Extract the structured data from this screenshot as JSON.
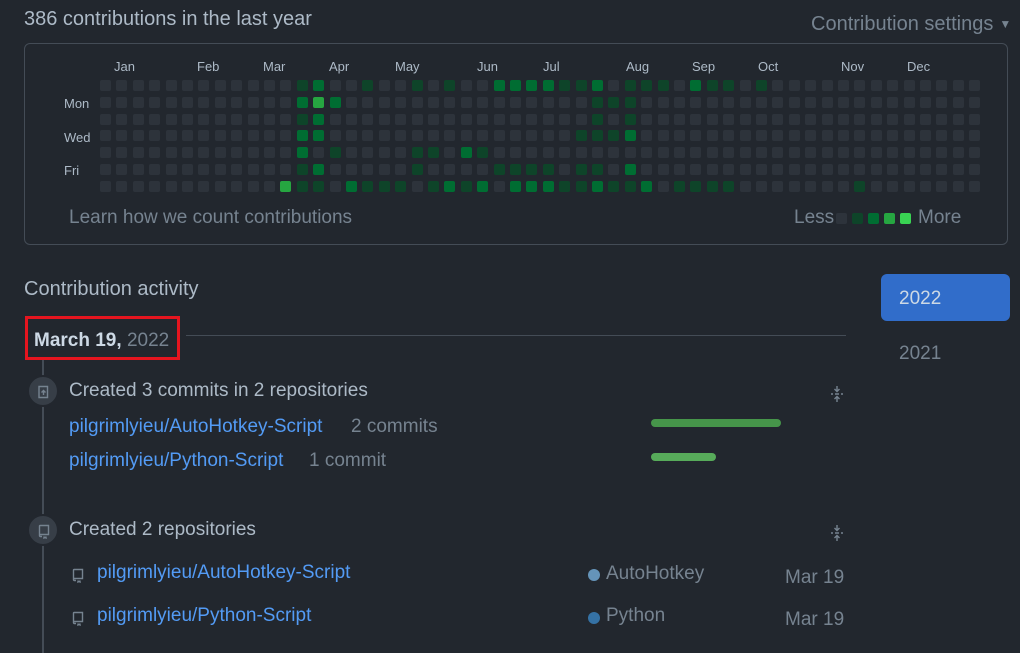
{
  "header": {
    "contrib_count": "386 contributions in the last year",
    "settings": "Contribution settings"
  },
  "calendar": {
    "months": [
      "Jan",
      "Feb",
      "Mar",
      "Apr",
      "May",
      "Jun",
      "Jul",
      "Aug",
      "Sep",
      "Oct",
      "Nov",
      "Dec"
    ],
    "days": [
      "Mon",
      "Wed",
      "Fri"
    ],
    "learn_link": "Learn how we count contributions",
    "legend_less": "Less",
    "legend_more": "More",
    "level_colors": [
      "#2d333b",
      "#0e4429",
      "#006d32",
      "#26a641",
      "#39d353"
    ],
    "weeks": 42,
    "active": [
      [
        11,
        6,
        3
      ],
      [
        12,
        0,
        1
      ],
      [
        12,
        1,
        2
      ],
      [
        12,
        2,
        1
      ],
      [
        12,
        3,
        2
      ],
      [
        12,
        4,
        2
      ],
      [
        12,
        5,
        1
      ],
      [
        12,
        6,
        1
      ],
      [
        13,
        0,
        2
      ],
      [
        13,
        1,
        3
      ],
      [
        13,
        2,
        2
      ],
      [
        13,
        3,
        2
      ],
      [
        13,
        5,
        2
      ],
      [
        13,
        6,
        1
      ],
      [
        14,
        1,
        2
      ],
      [
        14,
        4,
        1
      ],
      [
        15,
        6,
        2
      ],
      [
        16,
        0,
        1
      ],
      [
        16,
        6,
        1
      ],
      [
        17,
        6,
        1
      ],
      [
        18,
        6,
        1
      ],
      [
        19,
        0,
        1
      ],
      [
        19,
        4,
        1
      ],
      [
        19,
        5,
        1
      ],
      [
        20,
        4,
        1
      ],
      [
        20,
        6,
        1
      ],
      [
        21,
        0,
        1
      ],
      [
        21,
        6,
        2
      ],
      [
        22,
        4,
        2
      ],
      [
        22,
        6,
        1
      ],
      [
        23,
        4,
        1
      ],
      [
        23,
        6,
        2
      ],
      [
        24,
        0,
        2
      ],
      [
        24,
        5,
        1
      ],
      [
        25,
        0,
        2
      ],
      [
        25,
        5,
        1
      ],
      [
        25,
        6,
        2
      ],
      [
        26,
        0,
        2
      ],
      [
        26,
        5,
        1
      ],
      [
        26,
        6,
        2
      ],
      [
        27,
        0,
        2
      ],
      [
        27,
        5,
        1
      ],
      [
        27,
        6,
        2
      ],
      [
        28,
        0,
        1
      ],
      [
        28,
        6,
        1
      ],
      [
        29,
        0,
        1
      ],
      [
        29,
        3,
        1
      ],
      [
        29,
        5,
        1
      ],
      [
        29,
        6,
        1
      ],
      [
        30,
        0,
        2
      ],
      [
        30,
        1,
        1
      ],
      [
        30,
        2,
        1
      ],
      [
        30,
        3,
        1
      ],
      [
        30,
        5,
        1
      ],
      [
        30,
        6,
        2
      ],
      [
        31,
        1,
        1
      ],
      [
        31,
        3,
        1
      ],
      [
        31,
        6,
        1
      ],
      [
        32,
        0,
        1
      ],
      [
        32,
        1,
        1
      ],
      [
        32,
        2,
        1
      ],
      [
        32,
        3,
        2
      ],
      [
        32,
        5,
        2
      ],
      [
        32,
        6,
        1
      ],
      [
        33,
        0,
        1
      ],
      [
        33,
        6,
        2
      ],
      [
        34,
        0,
        1
      ],
      [
        35,
        6,
        1
      ],
      [
        36,
        0,
        2
      ],
      [
        36,
        6,
        1
      ],
      [
        37,
        0,
        1
      ],
      [
        37,
        6,
        1
      ],
      [
        38,
        0,
        1
      ],
      [
        38,
        6,
        1
      ],
      [
        40,
        0,
        1
      ],
      [
        46,
        6,
        1
      ]
    ]
  },
  "activity": {
    "title": "Contribution activity",
    "years": [
      "2022",
      "2021"
    ],
    "date_month_day": "March 19,",
    "date_year": "2022",
    "commits": {
      "title": "Created 3 commits in 2 repositories",
      "repos": [
        {
          "name": "pilgrimlyieu/AutoHotkey-Script",
          "count": "2 commits",
          "fraction": 1.0
        },
        {
          "name": "pilgrimlyieu/Python-Script",
          "count": "1 commit",
          "fraction": 0.5
        }
      ],
      "bar_color": "#46954a"
    },
    "repositories": {
      "title": "Created 2 repositories",
      "items": [
        {
          "name": "pilgrimlyieu/AutoHotkey-Script",
          "language": "AutoHotkey",
          "lang_color": "#6594b9",
          "date": "Mar 19"
        },
        {
          "name": "pilgrimlyieu/Python-Script",
          "language": "Python",
          "lang_color": "#3572A5",
          "date": "Mar 19"
        }
      ]
    }
  }
}
